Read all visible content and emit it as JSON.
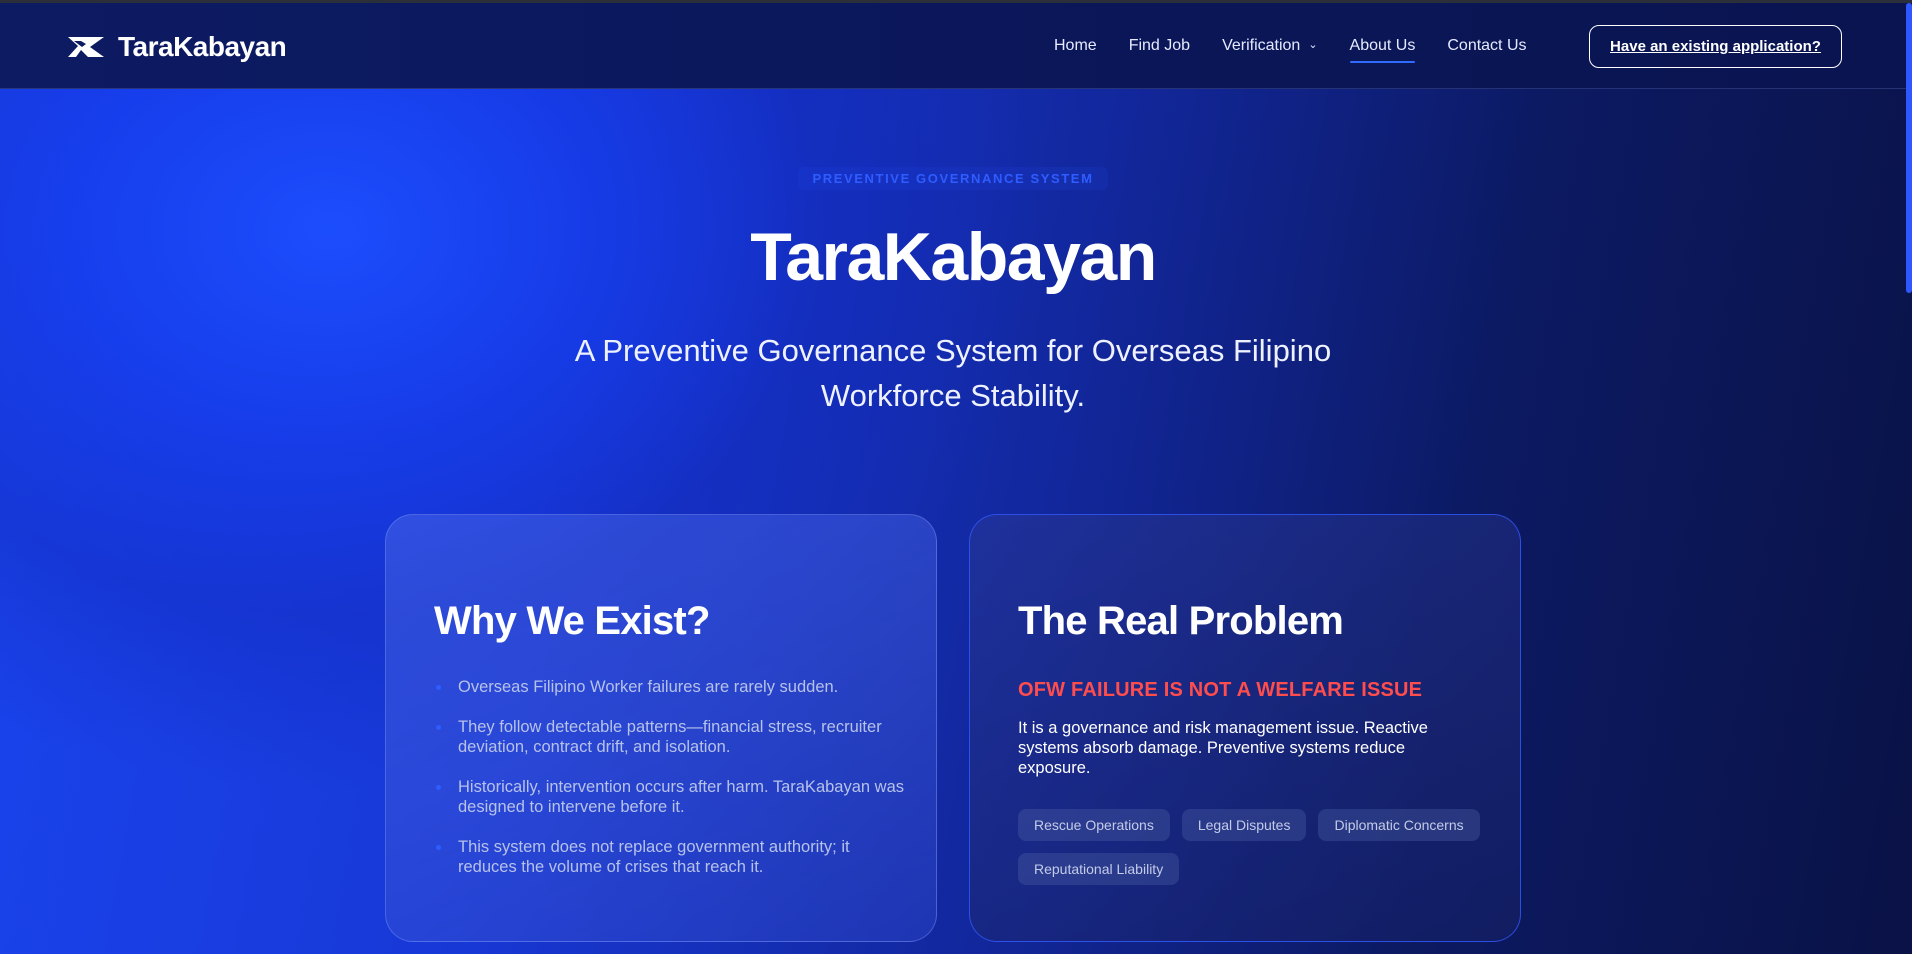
{
  "header": {
    "brand_name": "TaraKabayan",
    "nav": [
      {
        "label": "Home",
        "active": false
      },
      {
        "label": "Find Job",
        "active": false
      },
      {
        "label": "Verification",
        "active": false,
        "has_dropdown": true
      },
      {
        "label": "About Us",
        "active": true
      },
      {
        "label": "Contact Us",
        "active": false
      }
    ],
    "cta_label": "Have an existing application?"
  },
  "hero": {
    "eyebrow": "PREVENTIVE GOVERNANCE SYSTEM",
    "title": "TaraKabayan",
    "subtitle": "A Preventive Governance System for Overseas Filipino Workforce Stability."
  },
  "cards": {
    "why": {
      "title": "Why We Exist?",
      "bullets": [
        "Overseas Filipino Worker failures are rarely sudden.",
        "They follow detectable patterns—financial stress, recruiter deviation, contract drift, and isolation.",
        "Historically, intervention occurs after harm. TaraKabayan was designed to intervene before it.",
        "This system does not replace government authority; it reduces the volume of crises that reach it."
      ]
    },
    "problem": {
      "title": "The Real Problem",
      "alert": "OFW FAILURE IS NOT A WELFARE ISSUE",
      "description": "It is a governance and risk management issue. Reactive systems absorb damage. Preventive systems reduce exposure.",
      "tags": [
        "Rescue Operations",
        "Legal Disputes",
        "Diplomatic Concerns",
        "Reputational Liability"
      ]
    }
  },
  "colors": {
    "accent": "#2f5cff",
    "alert": "#ff4d4d",
    "header_bg": "#0d1b63"
  },
  "icons": {
    "brand": "tarakabayan-logo-icon",
    "dropdown": "chevron-down-icon"
  }
}
